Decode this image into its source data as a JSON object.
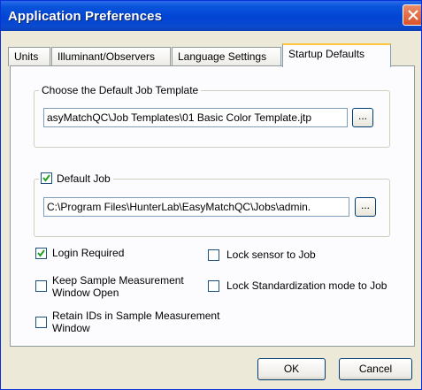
{
  "window": {
    "title": "Application Preferences"
  },
  "tabs": [
    {
      "label": "Units"
    },
    {
      "label": "Illuminant/Observers"
    },
    {
      "label": "Language Settings"
    },
    {
      "label": "Startup Defaults",
      "active": true
    }
  ],
  "job_template": {
    "group_label": "Choose the Default Job Template",
    "path": "asyMatchQC\\Job Templates\\01 Basic Color Template.jtp",
    "browse_label": "..."
  },
  "default_job": {
    "label": "Default Job",
    "checked": true,
    "path": "C:\\Program Files\\HunterLab\\EasyMatchQC\\Jobs\\admin.",
    "browse_label": "..."
  },
  "options": {
    "login_required": {
      "label": "Login Required",
      "checked": true
    },
    "keep_window_open": {
      "label_line1": "Keep Sample Measurement",
      "label_line2": "Window Open",
      "checked": false
    },
    "retain_ids": {
      "label_line1": "Retain IDs in Sample Measurement",
      "label_line2": "Window",
      "checked": false
    },
    "lock_sensor": {
      "label": "Lock sensor to Job",
      "checked": false
    },
    "lock_standardization": {
      "label": "Lock Standardization mode to Job",
      "checked": false
    }
  },
  "buttons": {
    "ok": "OK",
    "cancel": "Cancel"
  }
}
